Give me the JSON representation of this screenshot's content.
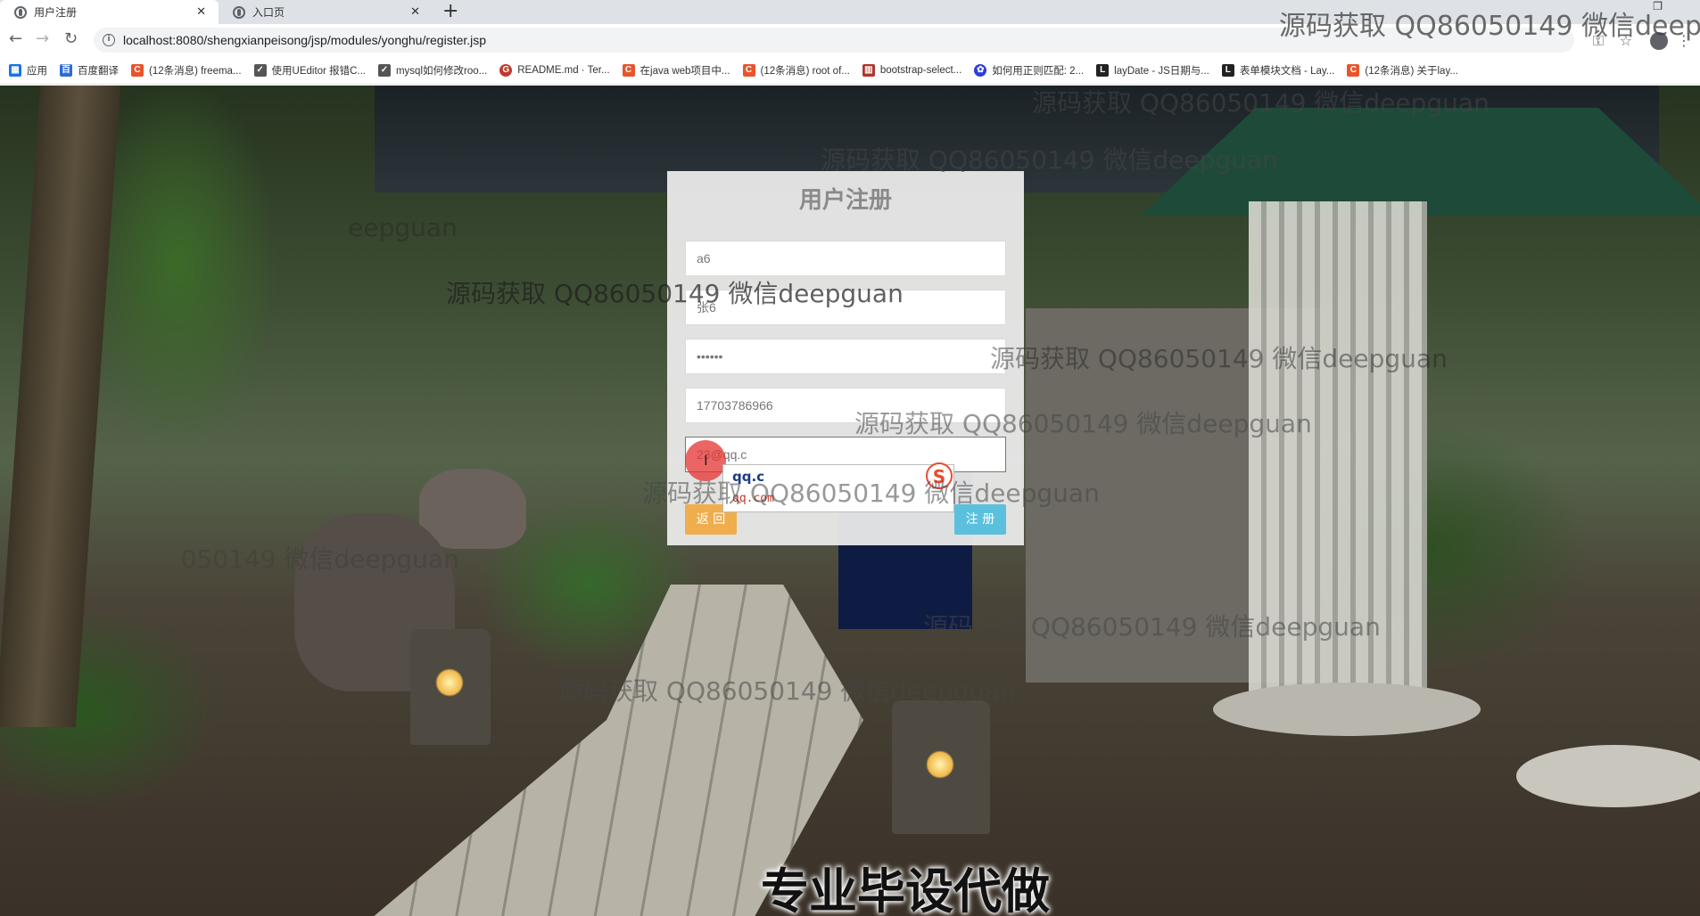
{
  "browser": {
    "tabs": [
      {
        "label": "用户注册",
        "active": true
      },
      {
        "label": "入口页",
        "active": false
      }
    ],
    "url": "localhost:8080/shengxianpeisong/jsp/modules/yonghu/register.jsp",
    "bookmarks": [
      {
        "label": "应用",
        "color": "#1a73e8"
      },
      {
        "label": "百度翻译",
        "color": "#2b6bd8"
      },
      {
        "label": "(12条消息) freema...",
        "color": "#e8542c"
      },
      {
        "label": "使用UEditor 报错C...",
        "color": "#333333"
      },
      {
        "label": "mysql如何修改roo...",
        "color": "#333333"
      },
      {
        "label": "README.md · Ter...",
        "color": "#c0392b"
      },
      {
        "label": "在java web项目中...",
        "color": "#e8542c"
      },
      {
        "label": "(12条消息) root of...",
        "color": "#e8542c"
      },
      {
        "label": "bootstrap-select...",
        "color": "#b0352b"
      },
      {
        "label": "如何用正则匹配: 2...",
        "color": "#2b3fd8"
      },
      {
        "label": "layDate - JS日期与...",
        "color": "#222222"
      },
      {
        "label": "表单模块文档 - Lay...",
        "color": "#222222"
      },
      {
        "label": "(12条消息) 关于lay...",
        "color": "#e8542c"
      }
    ]
  },
  "form": {
    "title": "用户注册",
    "fields": [
      {
        "value": "a6"
      },
      {
        "value": "张6"
      },
      {
        "value": "••••••"
      },
      {
        "value": "17703786966"
      },
      {
        "value": "23@qq.c"
      }
    ],
    "back_label": "返 回",
    "register_label": "注 册"
  },
  "ime": {
    "input": "qq.c",
    "candidate": "qq.com"
  },
  "overlay": {
    "watermark": "源码获取 QQ86050149 微信deepguan",
    "corner_watermark": "源码获取 QQ86050149 微信deepg",
    "caption": "专业毕设代做"
  }
}
